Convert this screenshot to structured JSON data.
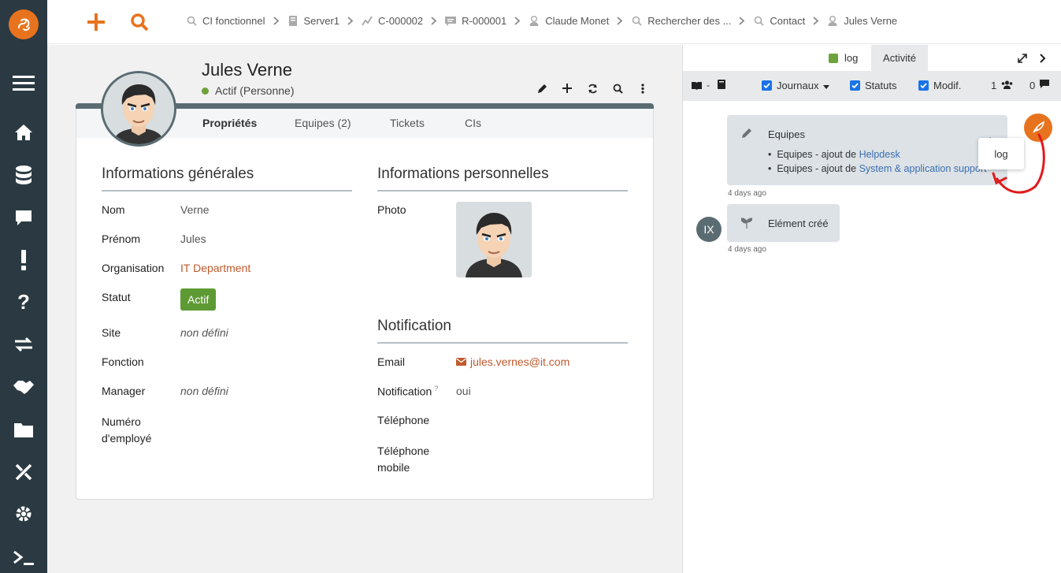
{
  "topbar": {
    "add_icon": "plus-icon",
    "search_icon": "search-icon",
    "breadcrumbs": [
      {
        "label": "CI fonctionnel",
        "icon": "search-icon"
      },
      {
        "label": "Server1",
        "icon": "server-icon"
      },
      {
        "label": "C-000002",
        "icon": "contract-icon"
      },
      {
        "label": "R-000001",
        "icon": "request-icon"
      },
      {
        "label": "Claude Monet",
        "icon": "person-icon"
      },
      {
        "label": "Rechercher des ...",
        "icon": "search-icon"
      },
      {
        "label": "Contact",
        "icon": "search-icon"
      },
      {
        "label": "Jules Verne",
        "icon": "person-icon"
      }
    ]
  },
  "sidebar": {
    "items": [
      "menu-icon",
      "home-icon",
      "database-icon",
      "chat-icon",
      "exclamation-icon",
      "question-icon",
      "exchange-icon",
      "handshake-icon",
      "folder-icon",
      "tools-icon",
      "gear-icon",
      "terminal-icon"
    ]
  },
  "object": {
    "name": "Jules Verne",
    "status": "Actif",
    "class": "(Personne)"
  },
  "tabs": [
    "Propriétés",
    "Equipes (2)",
    "Tickets",
    "CIs"
  ],
  "general": {
    "title": "Informations générales",
    "fields": [
      {
        "label": "Nom",
        "value": "Verne"
      },
      {
        "label": "Prénom",
        "value": "Jules"
      },
      {
        "label": "Organisation",
        "value": "IT Department"
      },
      {
        "label": "Statut",
        "value": "Actif"
      },
      {
        "label": "Site",
        "value": "non défini"
      },
      {
        "label": "Fonction",
        "value": ""
      },
      {
        "label": "Manager",
        "value": "non défini"
      },
      {
        "label": "Numéro d'employé",
        "value": ""
      }
    ]
  },
  "personal": {
    "title": "Informations personnelles",
    "photo_label": "Photo"
  },
  "notification": {
    "title": "Notification",
    "fields": [
      {
        "label": "Email",
        "value": "jules.vernes@it.com"
      },
      {
        "label": "Notification",
        "value": "oui",
        "help": "?"
      },
      {
        "label": "Téléphone",
        "value": ""
      },
      {
        "label": "Téléphone mobile",
        "value": ""
      }
    ]
  },
  "activity": {
    "tab_log": "log",
    "tab_activity": "Activité",
    "log_color": "#6ca33a",
    "filters": {
      "journaux": "Journaux",
      "statuts": "Statuts",
      "modif": "Modif.",
      "participants_count": "1",
      "comments_count": "0"
    },
    "entries": [
      {
        "title": "Equipes",
        "lines": [
          {
            "prefix": "Equipes - ajout de ",
            "link": "Helpdesk"
          },
          {
            "prefix": "Equipes - ajout de ",
            "link": "System & application support"
          }
        ],
        "time": "4 days ago"
      },
      {
        "avatar": "IX",
        "title": "Elément créé",
        "time": "4 days ago"
      }
    ],
    "popover": "log"
  },
  "colors": {
    "accent": "#e8731e",
    "sidebar": "#2b3a42",
    "status_green": "#5e9a34",
    "link": "#c0592b",
    "annotation": "#e01b1b"
  }
}
